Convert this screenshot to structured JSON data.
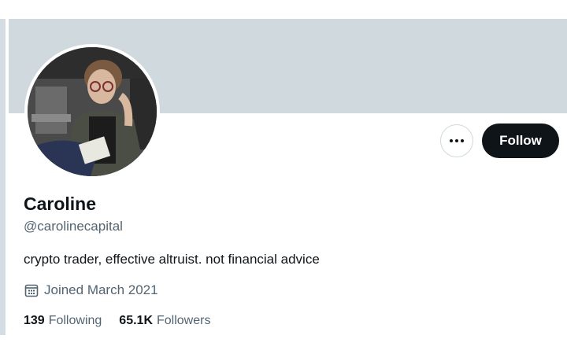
{
  "profile": {
    "name": "Caroline",
    "handle": "@carolinecapital",
    "bio": "crypto trader, effective altruist. not financial advice",
    "joined": "Joined March 2021"
  },
  "actions": {
    "more_icon": "ellipsis-icon",
    "follow_label": "Follow"
  },
  "stats": {
    "following_count": "139",
    "following_label": "Following",
    "followers_count": "65.1K",
    "followers_label": "Followers"
  },
  "icons": {
    "joined": "calendar-icon"
  },
  "colors": {
    "banner": "#cfd9de",
    "follow_bg": "#0f1419",
    "secondary_text": "#536471"
  }
}
